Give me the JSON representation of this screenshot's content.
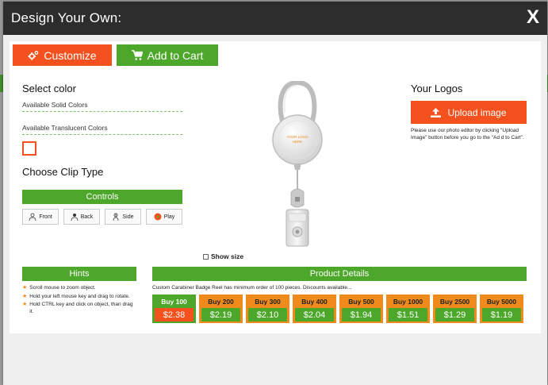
{
  "modal": {
    "title": "Design Your Own:",
    "close_label": "X"
  },
  "toolbar": {
    "customize_label": "Customize",
    "cart_label": "Add to Cart"
  },
  "left": {
    "select_color_heading": "Select color",
    "solid_colors_label": "Available Solid Colors",
    "translucent_colors_label": "Available Translucent Colors",
    "clip_type_heading": "Choose Clip Type",
    "controls_label": "Controls",
    "control_buttons": [
      {
        "label": "Front",
        "icon": "person-front-icon"
      },
      {
        "label": "Back",
        "icon": "person-back-icon"
      },
      {
        "label": "Side",
        "icon": "person-side-icon"
      },
      {
        "label": "Play",
        "icon": "play-icon"
      }
    ]
  },
  "preview": {
    "logo_placeholder_line1": "YOUR LOGO",
    "logo_placeholder_line2": "HERE",
    "show_size_label": "Show size"
  },
  "right": {
    "logos_heading": "Your Logos",
    "upload_label": "Upload image",
    "upload_note": "Please use our photo editor by clicking \"Upload Image\" button before you go to the \"Ad d to Cart\"."
  },
  "hints": {
    "title": "Hints",
    "items": [
      "Scroll mouse to zoom object.",
      "Hold your left mouse key and drag to rotate.",
      "Hold CTRL key and click on object, than drag it."
    ]
  },
  "product_details": {
    "title": "Product Details",
    "description": "Custom Carabiner Badge Reel has minimum order of 100 pieces. Discounts available...",
    "prices": [
      {
        "qty": "Buy 100",
        "price": "$2.38",
        "active": true
      },
      {
        "qty": "Buy 200",
        "price": "$2.19",
        "active": false
      },
      {
        "qty": "Buy 300",
        "price": "$2.10",
        "active": false
      },
      {
        "qty": "Buy 400",
        "price": "$2.04",
        "active": false
      },
      {
        "qty": "Buy 500",
        "price": "$1.94",
        "active": false
      },
      {
        "qty": "Buy 1000",
        "price": "$1.51",
        "active": false
      },
      {
        "qty": "Buy 2500",
        "price": "$1.29",
        "active": false
      },
      {
        "qty": "Buy 5000",
        "price": "$1.19",
        "active": false
      }
    ]
  },
  "colors": {
    "orange": "#f4511e",
    "green": "#4ca72a",
    "amber": "#f08a1c",
    "header": "#2d2d2d"
  }
}
